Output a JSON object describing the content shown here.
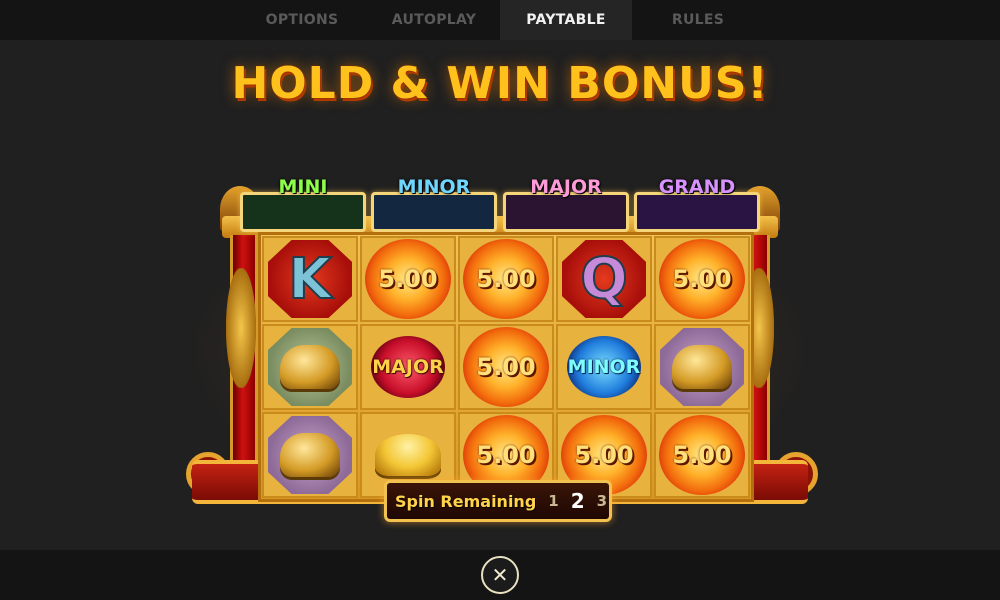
{
  "tabs": [
    {
      "label": "OPTIONS",
      "active": false
    },
    {
      "label": "AUTOPLAY",
      "active": false
    },
    {
      "label": "PAYTABLE",
      "active": true
    },
    {
      "label": "RULES",
      "active": false
    }
  ],
  "title": "HOLD & WIN BONUS!",
  "jackpots": [
    {
      "label": "MINI",
      "color": "#8dff4a",
      "box": "#14331a"
    },
    {
      "label": "MINOR",
      "color": "#6fd7ff",
      "box": "#132840"
    },
    {
      "label": "MAJOR",
      "color": "#ff9ad8",
      "box": "#2b1432"
    },
    {
      "label": "GRAND",
      "color": "#d892ff",
      "box": "#2a1444"
    }
  ],
  "reels": {
    "row1": [
      {
        "kind": "letter",
        "text": "K",
        "color": "#7cc3d8",
        "icon": "king-icon"
      },
      {
        "kind": "orb",
        "text": "5.00"
      },
      {
        "kind": "orb",
        "text": "5.00"
      },
      {
        "kind": "letter",
        "text": "Q",
        "color": "#c78ad8",
        "icon": "queen-icon"
      },
      {
        "kind": "orb",
        "text": "5.00"
      }
    ],
    "row2": [
      {
        "kind": "art",
        "icon": "laughing-buddha-icon",
        "bg": "green"
      },
      {
        "kind": "jewel",
        "text": "MAJOR",
        "variant": "major"
      },
      {
        "kind": "orb",
        "text": "5.00"
      },
      {
        "kind": "jewel",
        "text": "MINOR",
        "variant": "minor"
      },
      {
        "kind": "art",
        "icon": "golden-turtle-icon",
        "bg": "purple"
      }
    ],
    "row3": [
      {
        "kind": "art",
        "icon": "golden-turtle-icon",
        "bg": "purple"
      },
      {
        "kind": "ingot",
        "icon": "gold-ingot-icon"
      },
      {
        "kind": "orb",
        "text": "5.00"
      },
      {
        "kind": "orb",
        "text": "5.00"
      },
      {
        "kind": "orb",
        "text": "5.00"
      }
    ]
  },
  "spins": {
    "label": "Spin Remaining",
    "n1": "1",
    "n2": "2",
    "n3": "3",
    "current": "2"
  },
  "close_icon": "close-icon",
  "close_glyph": "✕"
}
